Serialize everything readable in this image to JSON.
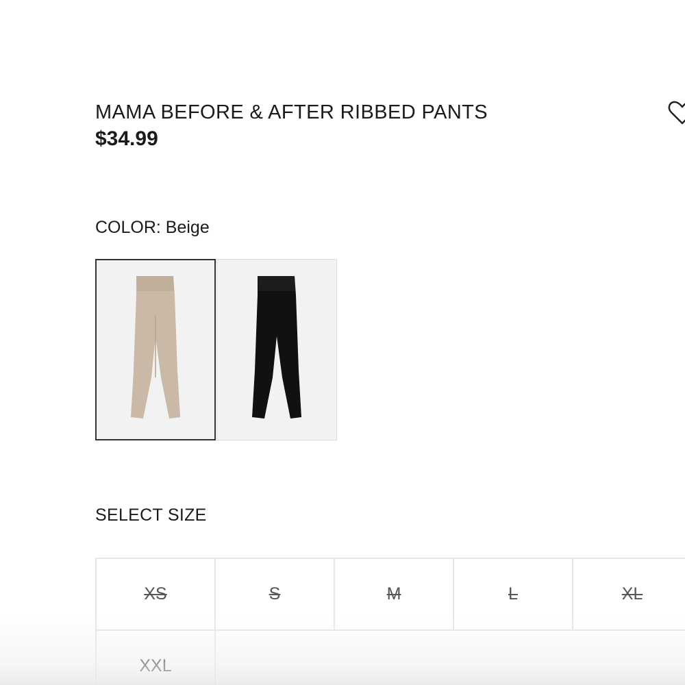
{
  "product": {
    "title": "MAMA BEFORE & AFTER RIBBED PANTS",
    "price": "$34.99"
  },
  "wishlist": {
    "icon": "heart-icon"
  },
  "color": {
    "label": "COLOR: Beige",
    "selected": "Beige",
    "swatches": [
      {
        "name": "Beige",
        "color": "#c9b9a6",
        "selected": true
      },
      {
        "name": "Black",
        "color": "#111111",
        "selected": false
      }
    ]
  },
  "size": {
    "label": "SELECT SIZE",
    "options": [
      {
        "label": "XS",
        "available": false
      },
      {
        "label": "S",
        "available": false
      },
      {
        "label": "M",
        "available": false
      },
      {
        "label": "L",
        "available": false
      },
      {
        "label": "XL",
        "available": false
      },
      {
        "label": "XXL",
        "available": true
      }
    ]
  }
}
